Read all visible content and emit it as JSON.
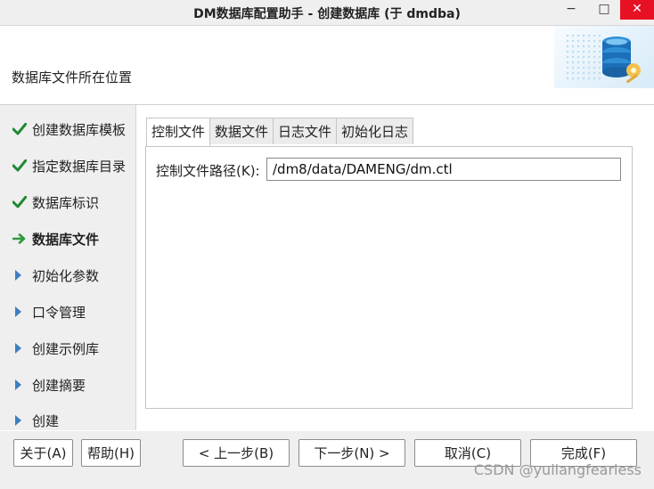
{
  "window": {
    "title": "DM数据库配置助手 - 创建数据库 (于 dmdba)",
    "minimize_symbol": "−",
    "maximize_symbol": "□",
    "close_symbol": "✕"
  },
  "header": {
    "title": "数据库文件所在位置",
    "art_icon": "database-gear-icon"
  },
  "steps": [
    {
      "label": "创建数据库模板",
      "status": "done",
      "icon": "check-icon"
    },
    {
      "label": "指定数据库目录",
      "status": "done",
      "icon": "check-icon"
    },
    {
      "label": "数据库标识",
      "status": "done",
      "icon": "check-icon"
    },
    {
      "label": "数据库文件",
      "status": "current",
      "icon": "arrow-right-icon"
    },
    {
      "label": "初始化参数",
      "status": "pending",
      "icon": "triangle-right-icon"
    },
    {
      "label": "口令管理",
      "status": "pending",
      "icon": "triangle-right-icon"
    },
    {
      "label": "创建示例库",
      "status": "pending",
      "icon": "triangle-right-icon"
    },
    {
      "label": "创建摘要",
      "status": "pending",
      "icon": "triangle-right-icon"
    },
    {
      "label": "创建",
      "status": "pending",
      "icon": "triangle-right-icon"
    }
  ],
  "tabs": [
    {
      "label": "控制文件",
      "active": true
    },
    {
      "label": "数据文件",
      "active": false
    },
    {
      "label": "日志文件",
      "active": false
    },
    {
      "label": "初始化日志",
      "active": false
    }
  ],
  "control_file": {
    "label": "控制文件路径(K):",
    "value": "/dm8/data/DAMENG/dm.ctl"
  },
  "buttons": {
    "about": "关于(A)",
    "help": "帮助(H)",
    "prev": "< 上一步(B)",
    "next": "下一步(N) >",
    "cancel": "取消(C)",
    "finish": "完成(F)"
  },
  "watermark": "CSDN @yuliangfearless",
  "colors": {
    "check": "#1f8a32",
    "arrow": "#2e9a3e",
    "triangle": "#3f7fc0",
    "close": "#e81123"
  }
}
